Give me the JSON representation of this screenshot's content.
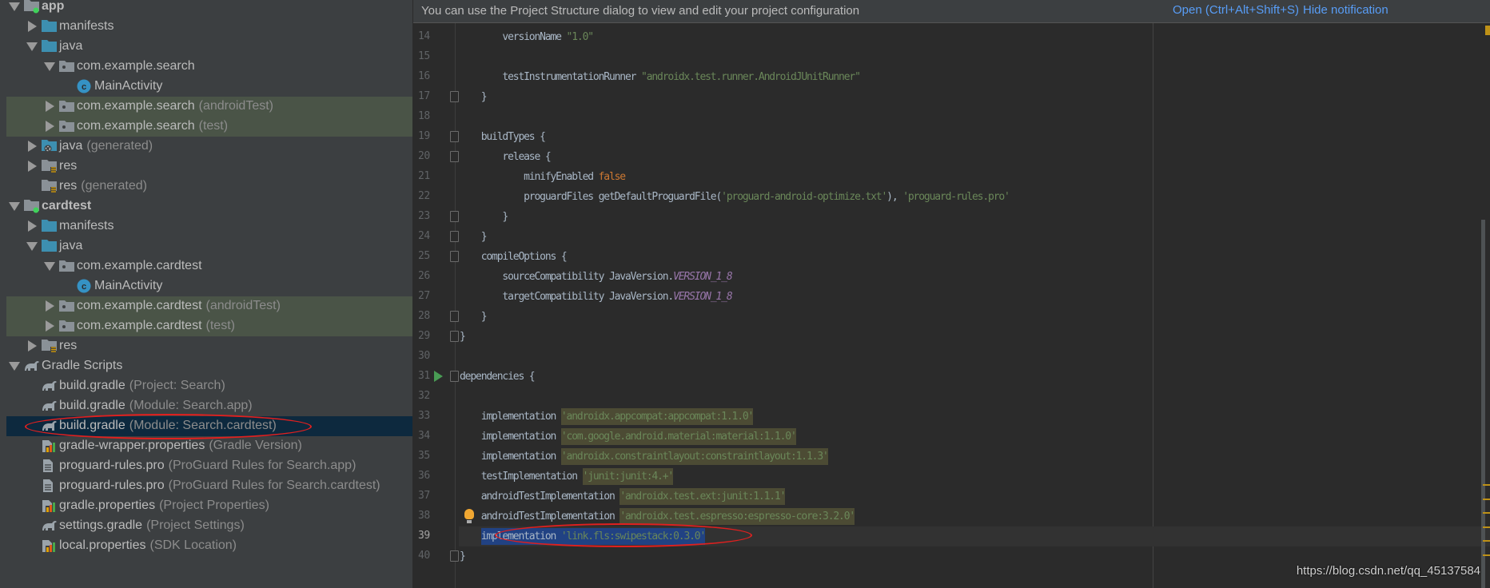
{
  "project_tree": [
    {
      "label": "app",
      "suffix": "",
      "level": 0,
      "arrow": "down",
      "icon": "module-folder-icon",
      "bold": true
    },
    {
      "label": "manifests",
      "suffix": "",
      "level": 1,
      "arrow": "right",
      "icon": "folder-icon"
    },
    {
      "label": "java",
      "suffix": "",
      "level": 1,
      "arrow": "down",
      "icon": "folder-icon"
    },
    {
      "label": "com.example.search",
      "suffix": "",
      "level": 2,
      "arrow": "down",
      "icon": "package-icon"
    },
    {
      "label": "MainActivity",
      "suffix": "",
      "level": 3,
      "arrow": null,
      "icon": "class-icon"
    },
    {
      "label": "com.example.search",
      "suffix": "(androidTest)",
      "level": 2,
      "arrow": "right",
      "icon": "package-icon",
      "highlight": true
    },
    {
      "label": "com.example.search",
      "suffix": "(test)",
      "level": 2,
      "arrow": "right",
      "icon": "package-icon",
      "highlight": true
    },
    {
      "label": "java",
      "suffix": "(generated)",
      "level": 1,
      "arrow": "right",
      "icon": "generated-folder-icon"
    },
    {
      "label": "res",
      "suffix": "",
      "level": 1,
      "arrow": "right",
      "icon": "res-folder-icon"
    },
    {
      "label": "res",
      "suffix": "(generated)",
      "level": 1,
      "arrow": null,
      "icon": "res-folder-icon"
    },
    {
      "label": "cardtest",
      "suffix": "",
      "level": 0,
      "arrow": "down",
      "icon": "module-folder-icon",
      "bold": true
    },
    {
      "label": "manifests",
      "suffix": "",
      "level": 1,
      "arrow": "right",
      "icon": "folder-icon"
    },
    {
      "label": "java",
      "suffix": "",
      "level": 1,
      "arrow": "down",
      "icon": "folder-icon"
    },
    {
      "label": "com.example.cardtest",
      "suffix": "",
      "level": 2,
      "arrow": "down",
      "icon": "package-icon"
    },
    {
      "label": "MainActivity",
      "suffix": "",
      "level": 3,
      "arrow": null,
      "icon": "class-icon"
    },
    {
      "label": "com.example.cardtest",
      "suffix": "(androidTest)",
      "level": 2,
      "arrow": "right",
      "icon": "package-icon",
      "highlight": true
    },
    {
      "label": "com.example.cardtest",
      "suffix": "(test)",
      "level": 2,
      "arrow": "right",
      "icon": "package-icon",
      "highlight": true
    },
    {
      "label": "res",
      "suffix": "",
      "level": 1,
      "arrow": "right",
      "icon": "res-folder-icon"
    },
    {
      "label": "Gradle Scripts",
      "suffix": "",
      "level": 0,
      "arrow": "down",
      "icon": "gradle-icon"
    },
    {
      "label": "build.gradle",
      "suffix": "(Project: Search)",
      "level": 1,
      "arrow": null,
      "icon": "gradle-icon"
    },
    {
      "label": "build.gradle",
      "suffix": "(Module: Search.app)",
      "level": 1,
      "arrow": null,
      "icon": "gradle-icon"
    },
    {
      "label": "build.gradle",
      "suffix": "(Module: Search.cardtest)",
      "level": 1,
      "arrow": null,
      "icon": "gradle-icon",
      "selected": true,
      "circled": true
    },
    {
      "label": "gradle-wrapper.properties",
      "suffix": "(Gradle Version)",
      "level": 1,
      "arrow": null,
      "icon": "properties-icon"
    },
    {
      "label": "proguard-rules.pro",
      "suffix": "(ProGuard Rules for Search.app)",
      "level": 1,
      "arrow": null,
      "icon": "text-file-icon"
    },
    {
      "label": "proguard-rules.pro",
      "suffix": "(ProGuard Rules for Search.cardtest)",
      "level": 1,
      "arrow": null,
      "icon": "text-file-icon"
    },
    {
      "label": "gradle.properties",
      "suffix": "(Project Properties)",
      "level": 1,
      "arrow": null,
      "icon": "properties-icon"
    },
    {
      "label": "settings.gradle",
      "suffix": "(Project Settings)",
      "level": 1,
      "arrow": null,
      "icon": "gradle-icon"
    },
    {
      "label": "local.properties",
      "suffix": "(SDK Location)",
      "level": 1,
      "arrow": null,
      "icon": "properties-icon"
    }
  ],
  "notification": {
    "message": "You can use the Project Structure dialog to view and edit your project configuration",
    "open_link": "Open (Ctrl+Alt+Shift+S)",
    "hide_link": "Hide notification"
  },
  "editor": {
    "caret_line": 39,
    "lines": [
      {
        "num": "14",
        "tokens": [
          {
            "t": "        versionName "
          },
          {
            "t": "\"1.0\"",
            "c": "str"
          }
        ]
      },
      {
        "num": "15",
        "tokens": []
      },
      {
        "num": "16",
        "tokens": [
          {
            "t": "        testInstrumentationRunner "
          },
          {
            "t": "\"androidx.test.runner.AndroidJUnitRunner\"",
            "c": "str"
          }
        ]
      },
      {
        "num": "17",
        "fold": true,
        "tokens": [
          {
            "t": "    }"
          }
        ]
      },
      {
        "num": "18",
        "tokens": []
      },
      {
        "num": "19",
        "fold": true,
        "tokens": [
          {
            "t": "    buildTypes {"
          }
        ]
      },
      {
        "num": "20",
        "fold": true,
        "tokens": [
          {
            "t": "        release {"
          }
        ]
      },
      {
        "num": "21",
        "tokens": [
          {
            "t": "            minifyEnabled "
          },
          {
            "t": "false",
            "c": "kw"
          }
        ]
      },
      {
        "num": "22",
        "tokens": [
          {
            "t": "            proguardFiles getDefaultProguardFile("
          },
          {
            "t": "'proguard-android-optimize.txt'",
            "c": "str"
          },
          {
            "t": "), "
          },
          {
            "t": "'proguard-rules.pro'",
            "c": "str"
          }
        ]
      },
      {
        "num": "23",
        "fold": true,
        "tokens": [
          {
            "t": "        }"
          }
        ]
      },
      {
        "num": "24",
        "fold": true,
        "tokens": [
          {
            "t": "    }"
          }
        ]
      },
      {
        "num": "25",
        "fold": true,
        "tokens": [
          {
            "t": "    compileOptions {"
          }
        ]
      },
      {
        "num": "26",
        "tokens": [
          {
            "t": "        sourceCompatibility JavaVersion."
          },
          {
            "t": "VERSION_1_8",
            "c": "const"
          }
        ]
      },
      {
        "num": "27",
        "tokens": [
          {
            "t": "        targetCompatibility JavaVersion."
          },
          {
            "t": "VERSION_1_8",
            "c": "const"
          }
        ]
      },
      {
        "num": "28",
        "fold": true,
        "tokens": [
          {
            "t": "    }"
          }
        ]
      },
      {
        "num": "29",
        "fold": true,
        "tokens": [
          {
            "t": "}"
          }
        ]
      },
      {
        "num": "30",
        "tokens": []
      },
      {
        "num": "31",
        "fold": true,
        "run": true,
        "tokens": [
          {
            "t": "dependencies {"
          }
        ]
      },
      {
        "num": "32",
        "tokens": []
      },
      {
        "num": "33",
        "tokens": [
          {
            "t": "    implementation "
          },
          {
            "t": "'androidx.appcompat:appcompat:1.1.0'",
            "c": "str hlb"
          }
        ]
      },
      {
        "num": "34",
        "tokens": [
          {
            "t": "    implementation "
          },
          {
            "t": "'com.google.android.material:material:1.1.0'",
            "c": "str hlb"
          }
        ]
      },
      {
        "num": "35",
        "tokens": [
          {
            "t": "    implementation "
          },
          {
            "t": "'androidx.constraintlayout:constraintlayout:1.1.3'",
            "c": "str hlb"
          }
        ]
      },
      {
        "num": "36",
        "tokens": [
          {
            "t": "    testImplementation "
          },
          {
            "t": "'junit:junit:4.+'",
            "c": "str hlb"
          }
        ]
      },
      {
        "num": "37",
        "tokens": [
          {
            "t": "    androidTestImplementation "
          },
          {
            "t": "'androidx.test.ext:junit:1.1.1'",
            "c": "str hlb"
          }
        ]
      },
      {
        "num": "38",
        "bulb": true,
        "tokens": [
          {
            "t": "    androidTestImplementation "
          },
          {
            "t": "'androidx.test.espresso:espresso-core:3.2.0'",
            "c": "str hlb"
          }
        ]
      },
      {
        "num": "39",
        "circled": true,
        "tokens": [
          {
            "t": "    "
          },
          {
            "t": "implementation ",
            "c": "selb"
          },
          {
            "t": "'link.fls:swipestack:0.3.0'",
            "c": "str selb"
          }
        ]
      },
      {
        "num": "40",
        "fold": true,
        "tokens": [
          {
            "t": "}"
          }
        ]
      }
    ]
  },
  "watermark": "https://blog.csdn.net/qq_45137584",
  "colors": {
    "accent_link": "#589df6",
    "selection": "#214283",
    "annotation": "#e0201f"
  }
}
